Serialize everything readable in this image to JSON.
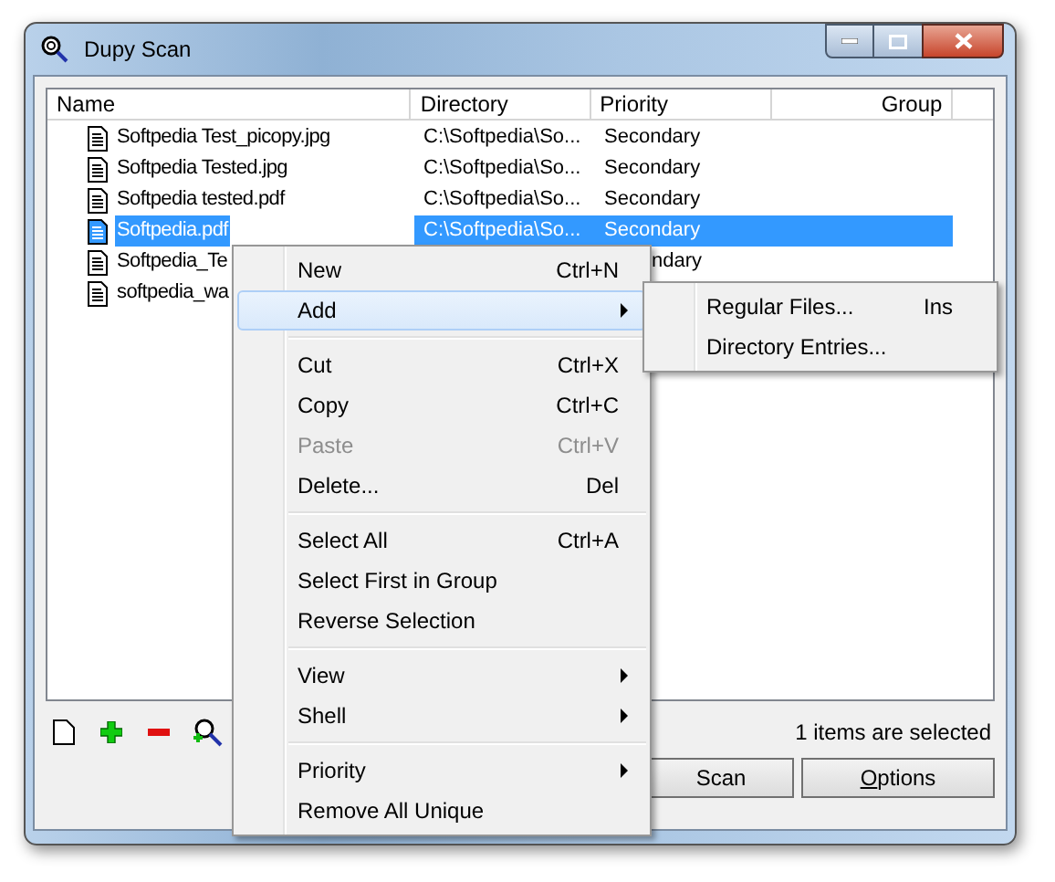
{
  "window": {
    "title": "Dupy Scan"
  },
  "table": {
    "columns": [
      "Name",
      "Directory",
      "Priority",
      "Group"
    ],
    "rows": [
      {
        "name": "Softpedia Test_picopy.jpg",
        "directory": "C:\\Softpedia\\So...",
        "priority": "Secondary",
        "selected": false,
        "kind": "full"
      },
      {
        "name": "Softpedia Tested.jpg",
        "directory": "C:\\Softpedia\\So...",
        "priority": "Secondary",
        "selected": false,
        "kind": "full"
      },
      {
        "name": "Softpedia tested.pdf",
        "directory": "C:\\Softpedia\\So...",
        "priority": "Secondary",
        "selected": false,
        "kind": "full"
      },
      {
        "name": "Softpedia.pdf",
        "directory": "C:\\Softpedia\\So...",
        "priority": "Secondary",
        "selected": true,
        "kind": "full"
      },
      {
        "name": "Softpedia_Te",
        "priority": "ndary",
        "selected": false,
        "kind": "covered"
      },
      {
        "name": "softpedia_wa",
        "selected": false,
        "kind": "covered"
      }
    ]
  },
  "status": "1 items are selected",
  "buttons": [
    "Scan",
    "Options"
  ],
  "context_menu": [
    [
      {
        "label": "New",
        "shortcut": "Ctrl+N",
        "disabled": false,
        "submenu": false,
        "selected": false
      },
      {
        "label": "Add",
        "disabled": false,
        "submenu": true,
        "selected": true
      }
    ],
    [
      {
        "label": "Cut",
        "shortcut": "Ctrl+X",
        "disabled": false,
        "submenu": false,
        "selected": false
      },
      {
        "label": "Copy",
        "shortcut": "Ctrl+C",
        "disabled": false,
        "submenu": false,
        "selected": false
      },
      {
        "label": "Paste",
        "shortcut": "Ctrl+V",
        "disabled": true,
        "submenu": false,
        "selected": false
      },
      {
        "label": "Delete...",
        "shortcut": "Del",
        "disabled": false,
        "submenu": false,
        "selected": false
      }
    ],
    [
      {
        "label": "Select All",
        "shortcut": "Ctrl+A",
        "disabled": false,
        "submenu": false,
        "selected": false
      },
      {
        "label": "Select First in Group",
        "disabled": false,
        "submenu": false,
        "selected": false
      },
      {
        "label": "Reverse Selection",
        "disabled": false,
        "submenu": false,
        "selected": false
      }
    ],
    [
      {
        "label": "View",
        "disabled": false,
        "submenu": true,
        "selected": false
      },
      {
        "label": "Shell",
        "disabled": false,
        "submenu": true,
        "selected": false
      }
    ],
    [
      {
        "label": "Priority",
        "disabled": false,
        "submenu": true,
        "selected": false
      },
      {
        "label": "Remove All Unique",
        "disabled": false,
        "submenu": false,
        "selected": false
      }
    ]
  ],
  "submenu": [
    {
      "label": "Regular Files...",
      "shortcut": "Ins"
    },
    {
      "label": "Directory Entries..."
    }
  ]
}
